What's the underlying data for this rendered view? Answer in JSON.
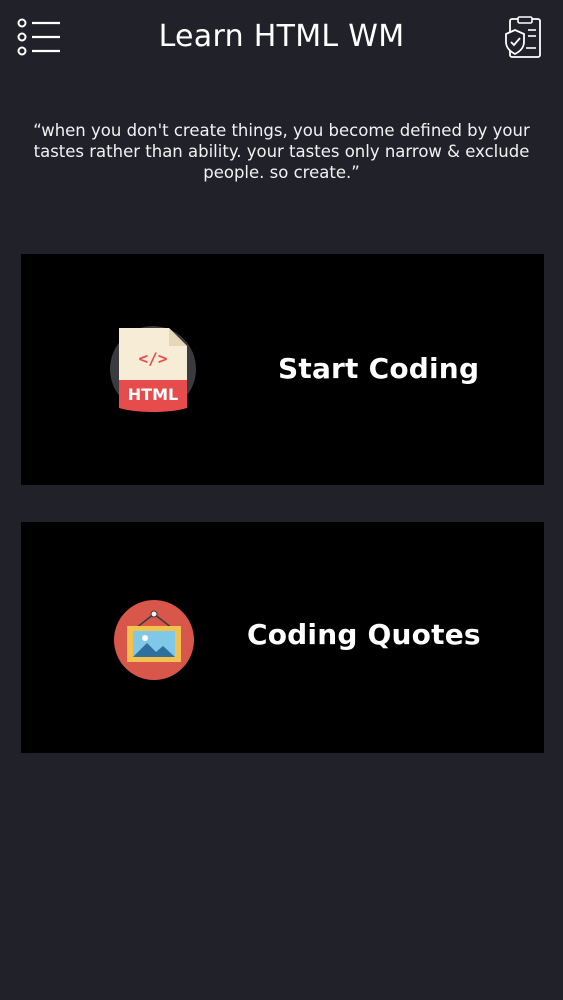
{
  "header": {
    "title": "Learn HTML WM",
    "menu_icon": "menu-list-icon",
    "privacy_icon": "privacy-document-shield-icon"
  },
  "quote": {
    "text": "“when you don't create things, you become defined by your tastes rather than ability. your tastes only narrow & exclude people. so create.”"
  },
  "cards": [
    {
      "label": "Start Coding",
      "icon": "html-file-icon",
      "icon_text": "HTML",
      "icon_code": "</>"
    },
    {
      "label": "Coding Quotes",
      "icon": "picture-frame-icon"
    }
  ],
  "colors": {
    "background": "#212129",
    "card": "#000000",
    "html_red": "#e74c4c",
    "frame_red": "#d9564a",
    "frame_yellow": "#f2c14e"
  }
}
